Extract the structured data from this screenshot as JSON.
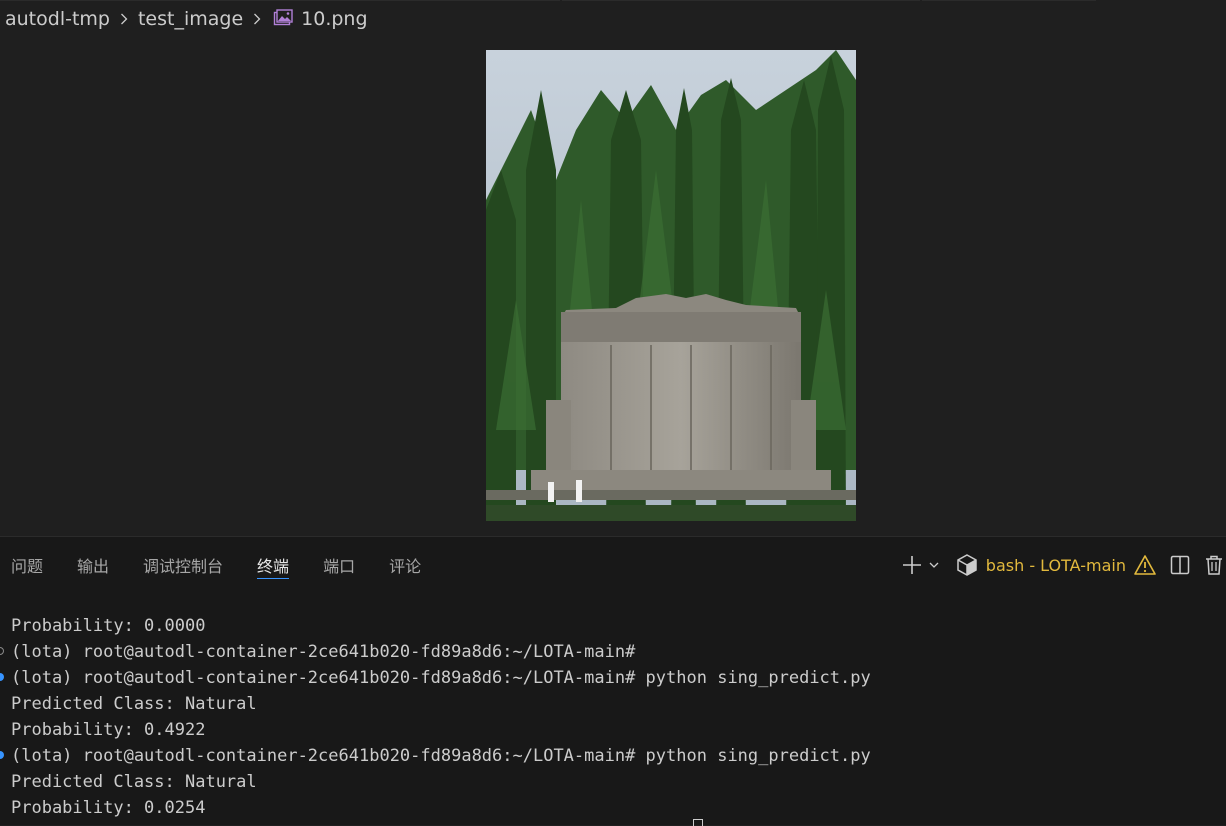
{
  "breadcrumb": {
    "items": [
      "autodl-tmp",
      "test_image"
    ],
    "file": "10.png",
    "file_icon": "image-file-icon"
  },
  "preview": {
    "image_description_icon": "image-preview"
  },
  "panel": {
    "tabs": [
      {
        "label": "问题",
        "active": false
      },
      {
        "label": "输出",
        "active": false
      },
      {
        "label": "调试控制台",
        "active": false
      },
      {
        "label": "终端",
        "active": true
      },
      {
        "label": "端口",
        "active": false
      },
      {
        "label": "评论",
        "active": false
      }
    ],
    "terminal_name": "bash - LOTA-main",
    "accent": "#3794ff",
    "warning_color": "#e2b93d"
  },
  "terminal": {
    "lines": [
      {
        "text": "Probability: 0.0000",
        "marker": ""
      },
      {
        "text": "(lota) root@autodl-container-2ce641b020-fd89a8d6:~/LOTA-main#",
        "marker": "gray"
      },
      {
        "text": "(lota) root@autodl-container-2ce641b020-fd89a8d6:~/LOTA-main# python sing_predict.py",
        "marker": "blue"
      },
      {
        "text": "Predicted Class: Natural",
        "marker": ""
      },
      {
        "text": "Probability: 0.4922",
        "marker": ""
      },
      {
        "text": "(lota) root@autodl-container-2ce641b020-fd89a8d6:~/LOTA-main# python sing_predict.py",
        "marker": "blue"
      },
      {
        "text": "Predicted Class: Natural",
        "marker": ""
      },
      {
        "text": "Probability: 0.0254",
        "marker": ""
      }
    ]
  }
}
